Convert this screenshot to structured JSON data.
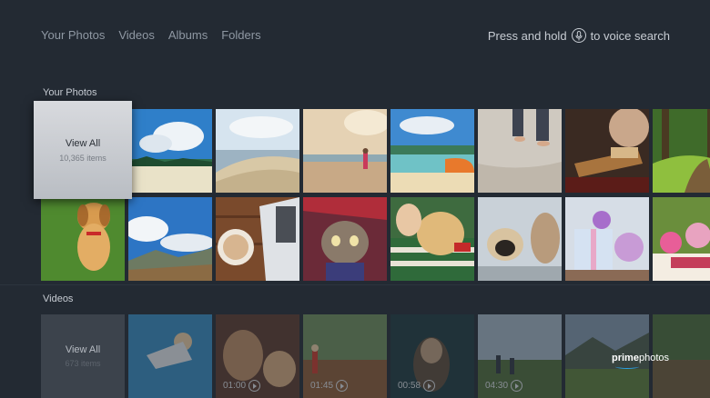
{
  "nav": {
    "tabs": [
      "Your Photos",
      "Videos",
      "Albums",
      "Folders"
    ],
    "voice_prefix": "Press and hold",
    "voice_suffix": "to voice search"
  },
  "photos": {
    "section_title": "Your Photos",
    "view_all_label": "View All",
    "item_count": "10,365 items"
  },
  "videos": {
    "section_title": "Videos",
    "view_all_label": "View All",
    "item_count": "673 items",
    "durations": [
      "",
      "01:00",
      "01:45",
      "00:58",
      "04:30"
    ]
  },
  "brand": {
    "logo_bold": "prime",
    "logo_rest": "photos",
    "accent": "#2aa3e8"
  },
  "colors": {
    "background": "#232a33",
    "text": "#c7ccd3",
    "nav_text": "#8f98a3"
  }
}
